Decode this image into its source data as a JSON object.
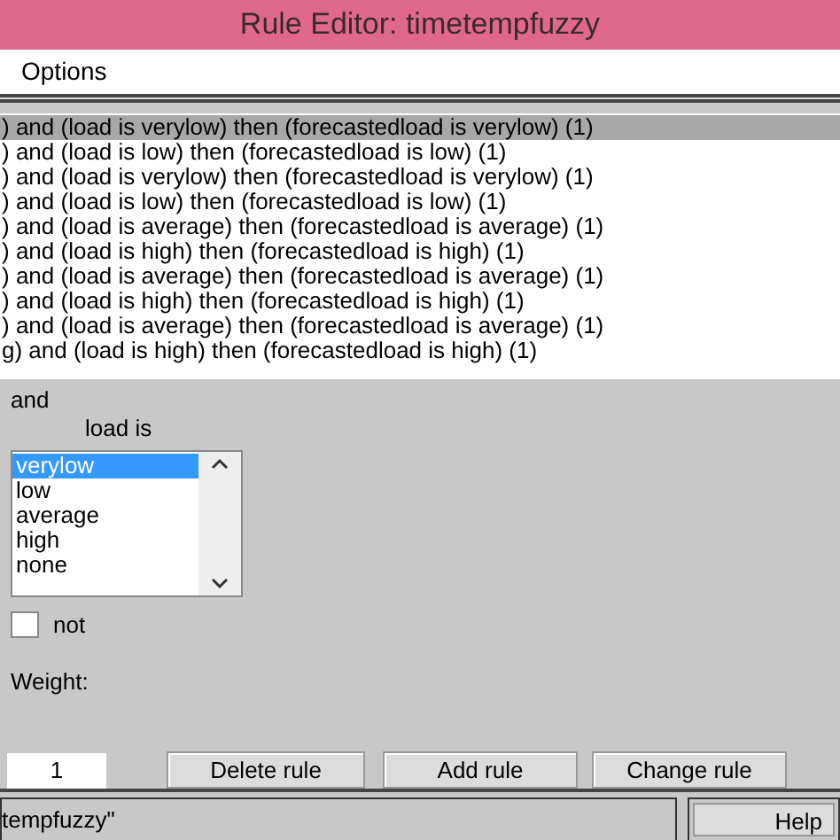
{
  "window": {
    "title": "Rule Editor: timetempfuzzy"
  },
  "menu": [
    "Options"
  ],
  "rules": [
    {
      "text": ") and (load is verylow) then (forecastedload is verylow) (1)",
      "selected": true
    },
    {
      "text": ") and (load is low) then (forecastedload is low) (1)",
      "selected": false
    },
    {
      "text": ") and (load is verylow) then (forecastedload is verylow) (1)",
      "selected": false
    },
    {
      "text": ") and (load is low) then (forecastedload is low) (1)",
      "selected": false
    },
    {
      "text": ") and (load is average) then (forecastedload is average) (1)",
      "selected": false
    },
    {
      "text": ") and (load is high) then (forecastedload is high) (1)",
      "selected": false
    },
    {
      "text": ") and (load is average) then (forecastedload is average) (1)",
      "selected": false
    },
    {
      "text": ") and (load is high) then (forecastedload is high) (1)",
      "selected": false
    },
    {
      "text": ") and (load is average) then (forecastedload is average) (1)",
      "selected": false
    },
    {
      "text": "g) and (load is high) then (forecastedload is high) (1)",
      "selected": false
    }
  ],
  "connective": "and",
  "variable_label": "load is",
  "terms": [
    {
      "label": "verylow",
      "selected": true
    },
    {
      "label": "low",
      "selected": false
    },
    {
      "label": "average",
      "selected": false
    },
    {
      "label": "high",
      "selected": false
    },
    {
      "label": "none",
      "selected": false
    }
  ],
  "not": {
    "label": "not",
    "checked": false
  },
  "weight": {
    "label": "Weight:",
    "value": "1"
  },
  "buttons": [
    "Delete rule",
    "Add rule",
    "Change rule"
  ],
  "status": "tempfuzzy\"",
  "help": "Help"
}
